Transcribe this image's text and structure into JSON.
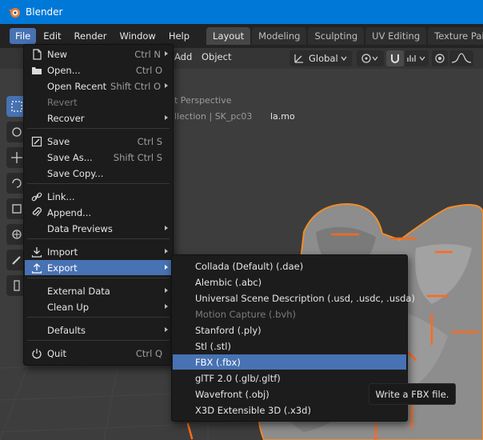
{
  "window": {
    "title": "Blender"
  },
  "menubar": {
    "items": [
      "File",
      "Edit",
      "Render",
      "Window",
      "Help"
    ],
    "active": "File"
  },
  "workspaces": {
    "tabs": [
      "Layout",
      "Modeling",
      "Sculpting",
      "UV Editing",
      "Texture Paint"
    ],
    "active": "Layout"
  },
  "viewport": {
    "menus": [
      "Add",
      "Object"
    ],
    "orientation": "Global",
    "overlay_text_1": "t Perspective",
    "overlay_text_2": "llection | SK_pc03",
    "object_name_suffix": "la.mo"
  },
  "file_menu": {
    "items": [
      {
        "label": "New",
        "shortcut": "Ctrl N",
        "icon": "new-file-icon",
        "submenu": true
      },
      {
        "label": "Open...",
        "shortcut": "Ctrl O",
        "icon": "folder-icon"
      },
      {
        "label": "Open Recent",
        "shortcut": "Shift Ctrl O",
        "submenu": true
      },
      {
        "label": "Revert",
        "disabled": true
      },
      {
        "label": "Recover",
        "submenu": true
      },
      {
        "label": "Save",
        "shortcut": "Ctrl S",
        "icon": "save-icon"
      },
      {
        "label": "Save As...",
        "shortcut": "Shift Ctrl S"
      },
      {
        "label": "Save Copy..."
      },
      {
        "label": "Link...",
        "icon": "link-icon"
      },
      {
        "label": "Append...",
        "icon": "append-icon"
      },
      {
        "label": "Data Previews",
        "submenu": true
      },
      {
        "label": "Import",
        "icon": "import-icon",
        "submenu": true
      },
      {
        "label": "Export",
        "icon": "export-icon",
        "submenu": true,
        "highlighted": true
      },
      {
        "label": "External Data",
        "submenu": true
      },
      {
        "label": "Clean Up",
        "submenu": true
      },
      {
        "label": "Defaults",
        "submenu": true
      },
      {
        "label": "Quit",
        "shortcut": "Ctrl Q",
        "icon": "power-icon"
      }
    ]
  },
  "export_menu": {
    "items": [
      {
        "label": "Collada (Default) (.dae)"
      },
      {
        "label": "Alembic (.abc)"
      },
      {
        "label": "Universal Scene Description (.usd, .usdc, .usda)"
      },
      {
        "label": "Motion Capture (.bvh)",
        "disabled": true
      },
      {
        "label": "Stanford (.ply)"
      },
      {
        "label": "Stl (.stl)"
      },
      {
        "label": "FBX (.fbx)",
        "highlighted": true
      },
      {
        "label": "glTF 2.0 (.glb/.gltf)"
      },
      {
        "label": "Wavefront (.obj)"
      },
      {
        "label": "X3D Extensible 3D (.x3d)"
      }
    ]
  },
  "tooltip": {
    "text": "Write a FBX file."
  },
  "colors": {
    "titlebar": "#0078d7",
    "accent": "#4772b3",
    "menu_bg": "#1c1c1c",
    "mesh_outline": "#f28c28",
    "bones": "#ff6a1a"
  }
}
